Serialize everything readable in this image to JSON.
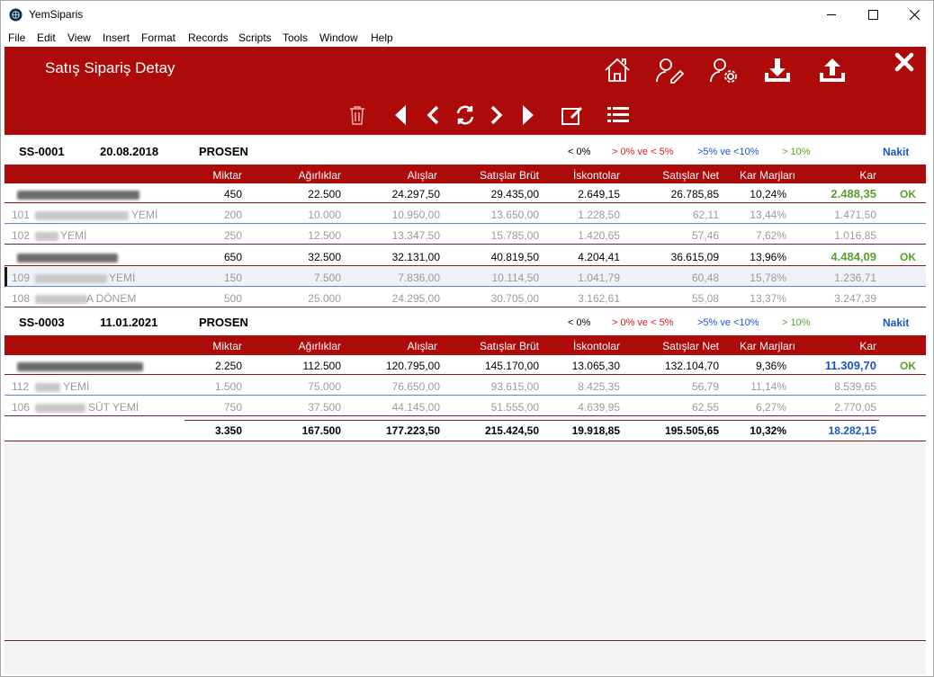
{
  "window": {
    "title": "YemSiparis"
  },
  "menu": [
    "File",
    "Edit",
    "View",
    "Insert",
    "Format",
    "Records",
    "Scripts",
    "Tools",
    "Window",
    "Help"
  ],
  "page": {
    "title": "Satış Sipariş Detay"
  },
  "colors": {
    "brand_red": "#ad0a0a",
    "green": "#5aa02c",
    "blue": "#1a54c8"
  },
  "legend": {
    "l0": "< 0%",
    "l1": "> 0% ve < 5%",
    "l2": ">5% ve <10%",
    "l3": "> 10%"
  },
  "columns": {
    "miktar": "Miktar",
    "agirlik": "Ağırlıklar",
    "alis": "Alışlar",
    "brut": "Satışlar Brüt",
    "iskonto": "İskontolar",
    "net": "Satışlar Net",
    "marj": "Kar Marjları",
    "kar": "Kar"
  },
  "groups": [
    {
      "code": "SS-0001",
      "date": "20.08.2018",
      "customer": "PROSEN",
      "payment": "Nakit",
      "rows": [
        {
          "no": "",
          "name": "",
          "miktar": "450",
          "agirlik": "22.500",
          "alis": "24.297,50",
          "brut": "29.435,00",
          "iskonto": "2.649,15",
          "net": "26.785,85",
          "marj": "10,24%",
          "kar": "2.488,35",
          "status": "OK"
        },
        {
          "no": "101",
          "name": "YEMİ",
          "miktar": "200",
          "agirlik": "10.000",
          "alis": "10.950,00",
          "brut": "13.650,00",
          "iskonto": "1.228,50",
          "net": "62,11",
          "marj": "13,44%",
          "kar": "1.471,50",
          "status": ""
        },
        {
          "no": "102",
          "name": "YEMİ",
          "miktar": "250",
          "agirlik": "12.500",
          "alis": "13.347,50",
          "brut": "15.785,00",
          "iskonto": "1.420,65",
          "net": "57,46",
          "marj": "7,62%",
          "kar": "1.016,85",
          "status": ""
        },
        {
          "no": "",
          "name": "",
          "miktar": "650",
          "agirlik": "32.500",
          "alis": "32.131,00",
          "brut": "40.819,50",
          "iskonto": "4.204,41",
          "net": "36.615,09",
          "marj": "13,96%",
          "kar": "4.484,09",
          "status": "OK"
        },
        {
          "no": "109",
          "name": "YEMİ",
          "miktar": "150",
          "agirlik": "7.500",
          "alis": "7.836,00",
          "brut": "10.114,50",
          "iskonto": "1.041,79",
          "net": "60,48",
          "marj": "15,78%",
          "kar": "1.236,71",
          "status": ""
        },
        {
          "no": "108",
          "name": "A DÖNEM",
          "miktar": "500",
          "agirlik": "25.000",
          "alis": "24.295,00",
          "brut": "30.705,00",
          "iskonto": "3.162,61",
          "net": "55,08",
          "marj": "13,37%",
          "kar": "3.247,39",
          "status": ""
        }
      ]
    },
    {
      "code": "SS-0003",
      "date": "11.01.2021",
      "customer": "PROSEN",
      "payment": "Nakit",
      "rows": [
        {
          "no": "",
          "name": "",
          "miktar": "2.250",
          "agirlik": "112.500",
          "alis": "120.795,00",
          "brut": "145.170,00",
          "iskonto": "13.065,30",
          "net": "132.104,70",
          "marj": "9,36%",
          "kar": "11.309,70",
          "status": "OK"
        },
        {
          "no": "112",
          "name": "YEMİ",
          "miktar": "1.500",
          "agirlik": "75.000",
          "alis": "76.650,00",
          "brut": "93.615,00",
          "iskonto": "8.425,35",
          "net": "56,79",
          "marj": "11,14%",
          "kar": "8.539,65",
          "status": ""
        },
        {
          "no": "106",
          "name": "SÜT YEMİ",
          "miktar": "750",
          "agirlik": "37.500",
          "alis": "44.145,00",
          "brut": "51.555,00",
          "iskonto": "4.639,95",
          "net": "62,55",
          "marj": "6,27%",
          "kar": "2.770,05",
          "status": ""
        }
      ]
    }
  ],
  "totals": {
    "miktar": "3.350",
    "agirlik": "167.500",
    "alis": "177.223,50",
    "brut": "215.424,50",
    "iskonto": "19.918,85",
    "net": "195.505,65",
    "marj": "10,32%",
    "kar": "18.282,15"
  }
}
